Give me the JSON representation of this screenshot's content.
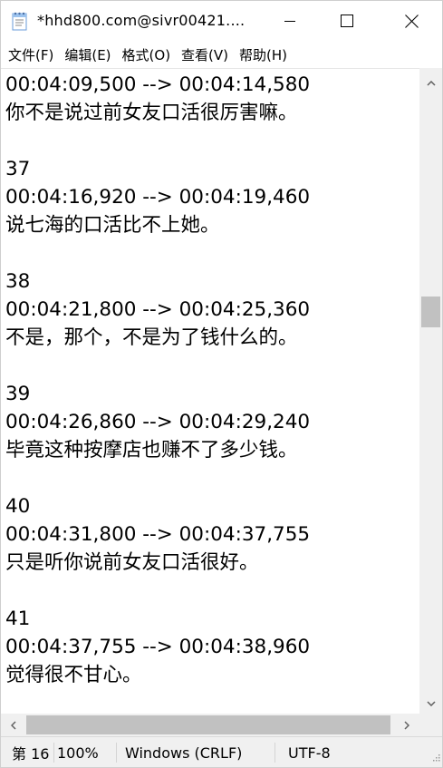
{
  "window": {
    "title": "*hhd800.com@sivr00421....",
    "icon": "notepad-icon"
  },
  "controls": {
    "minimize": "minimize-icon",
    "maximize": "maximize-icon",
    "close": "close-icon"
  },
  "menu": {
    "items": [
      {
        "label": "文件(F)"
      },
      {
        "label": "编辑(E)"
      },
      {
        "label": "格式(O)"
      },
      {
        "label": "查看(V)"
      },
      {
        "label": "帮助(H)"
      }
    ]
  },
  "editor": {
    "lines": [
      "00:04:09,500 --> 00:04:14,580",
      "你不是说过前女友口活很厉害嘛。",
      "",
      "37",
      "00:04:16,920 --> 00:04:19,460",
      "说七海的口活比不上她。",
      "",
      "38",
      "00:04:21,800 --> 00:04:25,360",
      "不是，那个，不是为了钱什么的。",
      "",
      "39",
      "00:04:26,860 --> 00:04:29,240",
      "毕竟这种按摩店也赚不了多少钱。",
      "",
      "40",
      "00:04:31,800 --> 00:04:37,755",
      "只是听你说前女友口活很好。",
      "",
      "41",
      "00:04:37,755 --> 00:04:38,960",
      "觉得很不甘心。",
      ""
    ]
  },
  "scrollbars": {
    "vertical_position": 0.36,
    "horizontal_position": 0.0
  },
  "status": {
    "position": "第 16",
    "zoom": "100%",
    "line_ending": "Windows (CRLF)",
    "encoding": "UTF-8"
  },
  "colors": {
    "chrome": "#f0f0f0",
    "thumb": "#c1c1c1",
    "text": "#000000"
  }
}
